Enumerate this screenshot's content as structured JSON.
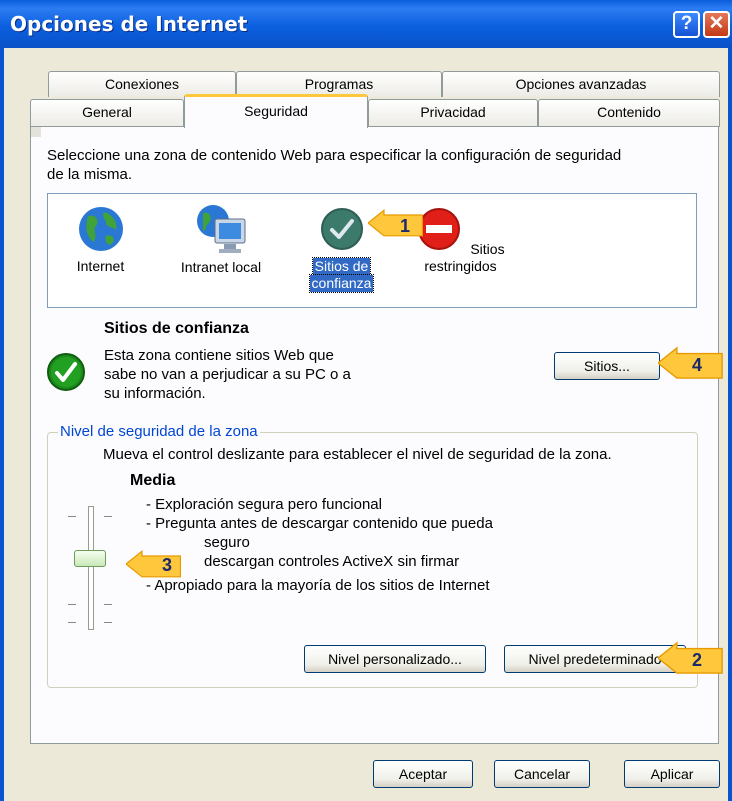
{
  "window": {
    "title": "Opciones de Internet"
  },
  "tabs_row1": [
    "Conexiones",
    "Programas",
    "Opciones avanzadas"
  ],
  "tabs_row2": [
    "General",
    "Seguridad",
    "Privacidad",
    "Contenido"
  ],
  "instructions": [
    "Seleccione una zona de contenido Web para especificar la configuración de seguridad",
    "de la misma."
  ],
  "zones": [
    {
      "label1": "Internet",
      "label2": "",
      "icon": "globe-icon"
    },
    {
      "label1": "Intranet local",
      "label2": "",
      "icon": "intranet-icon"
    },
    {
      "label1": "Sitios de",
      "label2": "confianza",
      "icon": "trusted-check-icon",
      "selected": true
    },
    {
      "label1": "Sitios",
      "label2": "restringidos",
      "icon": "restricted-icon"
    }
  ],
  "selected_zone": {
    "title": "Sitios de confianza",
    "desc": [
      "Esta zona contiene sitios Web que",
      "sabe no van a perjudicar a su PC o a",
      "su información."
    ],
    "sites_button": "Sitios..."
  },
  "security_level": {
    "group_label": "Nivel de seguridad de la zona",
    "instruction": "Mueva el control deslizante para establecer el nivel de seguridad de la zona.",
    "level_name": "Media",
    "bullets": [
      "- Exploración segura pero funcional",
      "- Pregunta antes de descargar contenido que pueda",
      "seguro",
      "descargan controles ActiveX sin firmar",
      "- Apropiado para la mayoría de los sitios de Internet"
    ],
    "custom_button": "Nivel personalizado...",
    "default_button": "Nivel predeterminado"
  },
  "footer": {
    "ok": "Aceptar",
    "cancel": "Cancelar",
    "apply": "Aplicar"
  },
  "callouts": [
    "1",
    "2",
    "3",
    "4"
  ],
  "colors": {
    "titlebar": "#0A5DDB",
    "face": "#ECE9D8",
    "selection": "#316AC5",
    "callout": "#FFC83C",
    "active_tab_accent": "#FFC83C"
  }
}
